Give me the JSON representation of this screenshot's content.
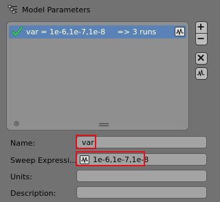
{
  "panel": {
    "title": "Model Parameters",
    "title_icon": "parameters-icon"
  },
  "parameter_list": {
    "items": [
      {
        "label": "var = 1e-6,1e-7,1e-8     => 3 runs",
        "enabled": true,
        "check_icon": "checkmark-icon",
        "edit_icon": "waveform-icon"
      }
    ],
    "add_icon": "add-small-icon",
    "resize_icon": "resize-grip-icon"
  },
  "side_buttons": [
    {
      "name": "add-parameter-button",
      "icon": "plus-icon"
    },
    {
      "name": "remove-parameter-button",
      "icon": "minus-icon"
    },
    {
      "name": "clear-parameters-button",
      "icon": "x-icon"
    },
    {
      "name": "waveform-button",
      "icon": "waveform-icon"
    }
  ],
  "properties": {
    "name": {
      "label": "Name:",
      "value": "var"
    },
    "sweep": {
      "label": "Sweep Expressi...",
      "value": "1e-6,1e-7,1e-8",
      "icon": "waveform-icon"
    },
    "units": {
      "label": "Units:",
      "value": ""
    },
    "description": {
      "label": "Description:",
      "value": ""
    }
  },
  "colors": {
    "background": "#727272",
    "selected_row": "#5a82b7",
    "highlight": "#e3101b",
    "check": "#2fc65a"
  }
}
